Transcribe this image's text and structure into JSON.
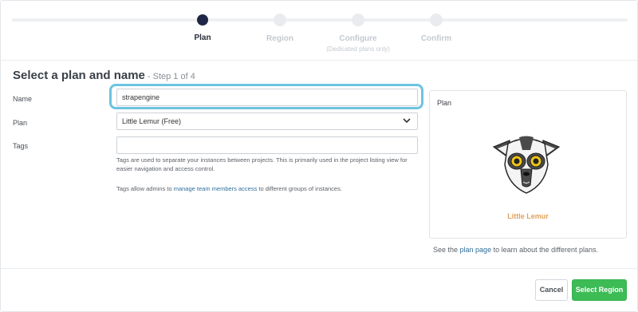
{
  "stepper": {
    "steps": [
      {
        "label": "Plan",
        "sub": "",
        "active": true
      },
      {
        "label": "Region",
        "sub": "",
        "active": false
      },
      {
        "label": "Configure",
        "sub": "(Dedicated plans only)",
        "active": false
      },
      {
        "label": "Confirm",
        "sub": "",
        "active": false
      }
    ]
  },
  "heading": {
    "title": "Select a plan and name",
    "step": "- Step 1 of 4"
  },
  "form": {
    "name_label": "Name",
    "name_value": "strapengine",
    "plan_label": "Plan",
    "plan_value": "Little Lemur (Free)",
    "tags_label": "Tags",
    "tags_value": "",
    "tags_help_1": "Tags are used to separate your instances between projects. This is primarily used in the project listing view for easier navigation and access control.",
    "tags_help_2_pre": "Tags allow admins to ",
    "tags_help_2_link": "manage team members access",
    "tags_help_2_post": " to different groups of instances."
  },
  "plan_card": {
    "title": "Plan",
    "name": "Little Lemur",
    "icon": "lemur-icon",
    "accent_color": "#e0a05a"
  },
  "plan_note": {
    "pre": "See the ",
    "link": "plan page",
    "post": " to learn about the different plans."
  },
  "footer": {
    "cancel_label": "Cancel",
    "primary_label": "Select Region",
    "primary_color": "#3dbb55"
  }
}
